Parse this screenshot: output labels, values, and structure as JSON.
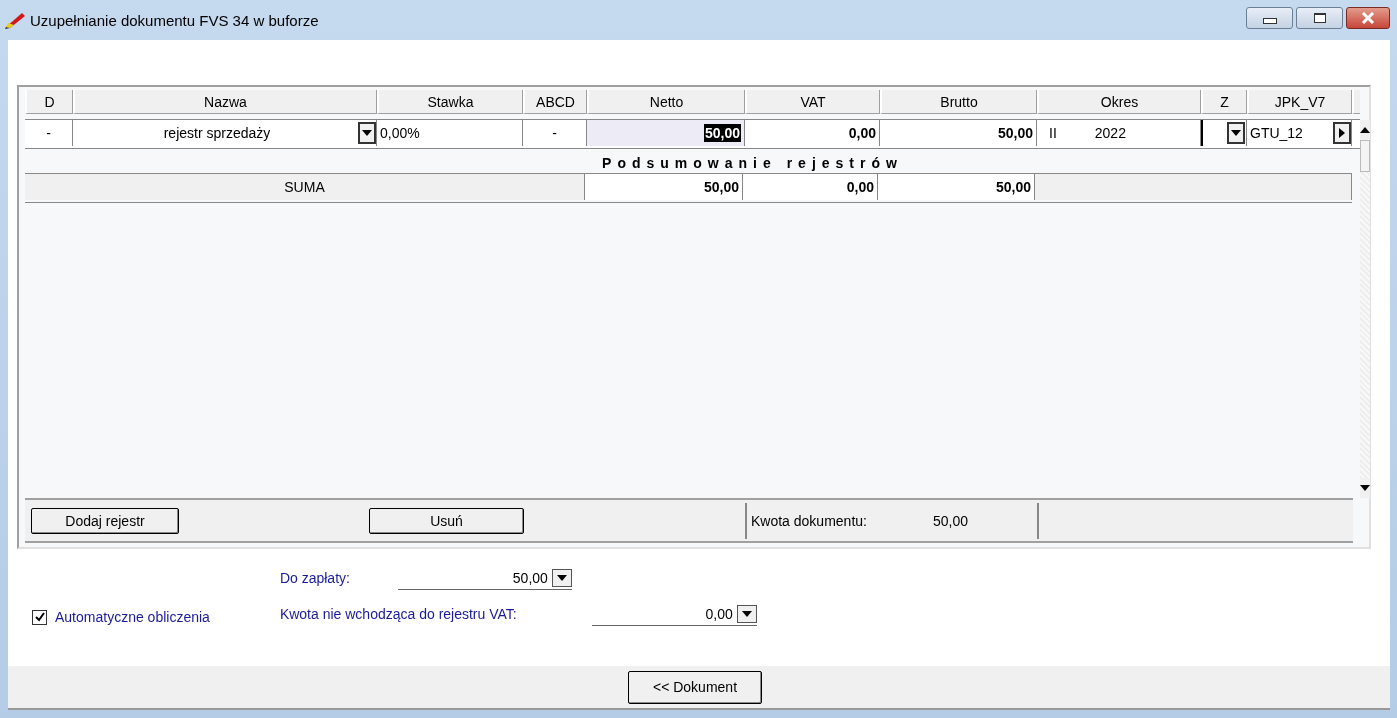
{
  "window": {
    "title": "Uzupełnianie dokumentu FVS 34 w buforze"
  },
  "table": {
    "columns": [
      "D",
      "Nazwa",
      "Stawka",
      "ABCD",
      "Netto",
      "VAT",
      "Brutto",
      "Okres",
      "Z",
      "JPK_V7"
    ],
    "rows": [
      {
        "d": "-",
        "nazwa": "rejestr sprzedaży",
        "stawka": "0,00%",
        "abcd": "-",
        "netto": "50,00",
        "netto_selected": true,
        "vat": "0,00",
        "brutto": "50,00",
        "okres_month": "II",
        "okres_year": "2022",
        "jpk": "GTU_12"
      }
    ]
  },
  "summary": {
    "title": "Podsumowanie rejestrów",
    "label": "SUMA",
    "netto": "50,00",
    "vat": "0,00",
    "brutto": "50,00"
  },
  "panel_footer": {
    "buttons": [
      "Dodaj rejestr",
      "Usuń"
    ],
    "amount_label": "Kwota dokumentu:",
    "amount": "50,00"
  },
  "form": {
    "auto_calc": {
      "label": "Automatyczne obliczenia",
      "checked": true
    },
    "fields": [
      {
        "label": "Do zapłaty:",
        "value": "50,00"
      },
      {
        "label": "Kwota nie wchodząca do rejestru VAT:",
        "value": "0,00"
      }
    ]
  },
  "bottom_button": "<< Dokument"
}
